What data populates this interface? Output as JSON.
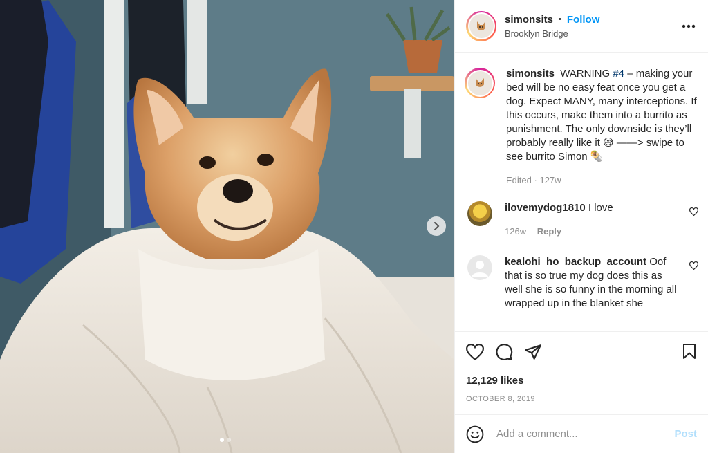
{
  "post": {
    "username": "simonsits",
    "separator": "•",
    "follow_label": "Follow",
    "location": "Brooklyn Bridge",
    "more_icon": "more-horizontal-icon",
    "next_icon": "chevron-right-icon",
    "carousel": {
      "slides": 2,
      "active": 1
    }
  },
  "caption": {
    "username": "simonsits",
    "text_before": "WARNING",
    "hashtag": "#4",
    "text_after": "– making your bed will be no easy feat once you get a dog. Expect MANY, many interceptions. If this occurs, make them into a burrito as punishment. The only downside is they’ll probably really like it 😅 ——> swipe to see burrito Simon 🌯",
    "edited": "Edited",
    "dot": "·",
    "age": "127w"
  },
  "comments": [
    {
      "username": "ilovemydog1810",
      "text": "I love",
      "age": "126w",
      "reply_label": "Reply"
    },
    {
      "username": "kealohi_ho_backup_account",
      "text": "Oof that is so true my dog does this as well she is so funny in the morning all wrapped up in the blanket she"
    }
  ],
  "actions": {
    "icons": [
      "heart-icon",
      "comment-icon",
      "share-icon",
      "bookmark-icon"
    ],
    "likes": "12,129 likes",
    "date": "OCTOBER 8, 2019"
  },
  "composer": {
    "emoji_icon": "emoji-icon",
    "placeholder": "Add a comment...",
    "post_label": "Post"
  },
  "colors": {
    "link_blue": "#0095f6",
    "hashtag": "#00376b",
    "muted": "#8e8e8e",
    "post_disabled": "#b2dffc"
  }
}
